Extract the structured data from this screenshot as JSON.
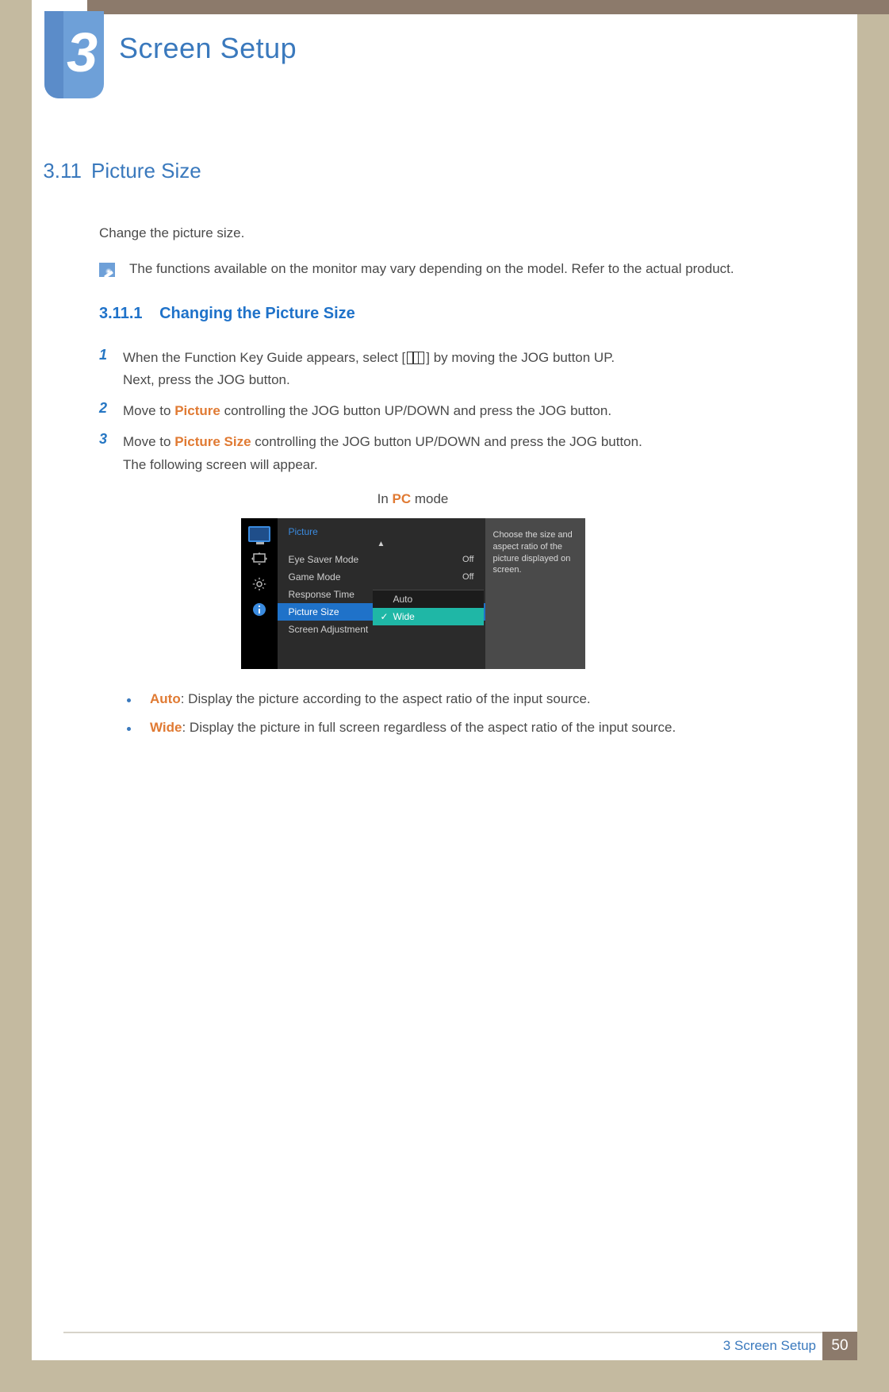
{
  "chapter": {
    "number": "3",
    "title": "Screen Setup"
  },
  "section": {
    "number": "3.11",
    "title": "Picture Size",
    "intro": "Change the picture size.",
    "note": "The functions available on the monitor may vary depending on the model. Refer to the actual product."
  },
  "subsection": {
    "number": "3.11.1",
    "title": "Changing the Picture Size"
  },
  "steps": {
    "s1": {
      "num": "1",
      "a": "When the Function Key Guide appears, select [",
      "b": "] by moving the JOG button UP.",
      "c": "Next, press the JOG button."
    },
    "s2": {
      "num": "2",
      "a": "Move to ",
      "kw": "Picture",
      "b": " controlling the JOG button UP/DOWN and press the JOG button."
    },
    "s3": {
      "num": "3",
      "a": "Move to ",
      "kw": "Picture Size",
      "b": " controlling the JOG button UP/DOWN and press the JOG button.",
      "c": "The following screen will appear."
    }
  },
  "mode": {
    "prefix": "In ",
    "kw": "PC",
    "suffix": " mode"
  },
  "osd": {
    "header": "Picture",
    "rows": {
      "eye": {
        "label": "Eye Saver Mode",
        "value": "Off"
      },
      "game": {
        "label": "Game Mode",
        "value": "Off"
      },
      "response": {
        "label": "Response Time"
      },
      "size": {
        "label": "Picture Size"
      },
      "adjust": {
        "label": "Screen Adjustment"
      }
    },
    "popup": {
      "opt1": "Auto",
      "opt2": "Wide"
    },
    "help": "Choose the size and aspect ratio of the picture displayed on screen."
  },
  "bullets": {
    "b1": {
      "kw": "Auto",
      "txt": ": Display the picture according to the aspect ratio of the input source."
    },
    "b2": {
      "kw": "Wide",
      "txt": ": Display the picture in full screen regardless of the aspect ratio of the input source."
    }
  },
  "footer": {
    "label": "3 Screen Setup",
    "page": "50"
  }
}
